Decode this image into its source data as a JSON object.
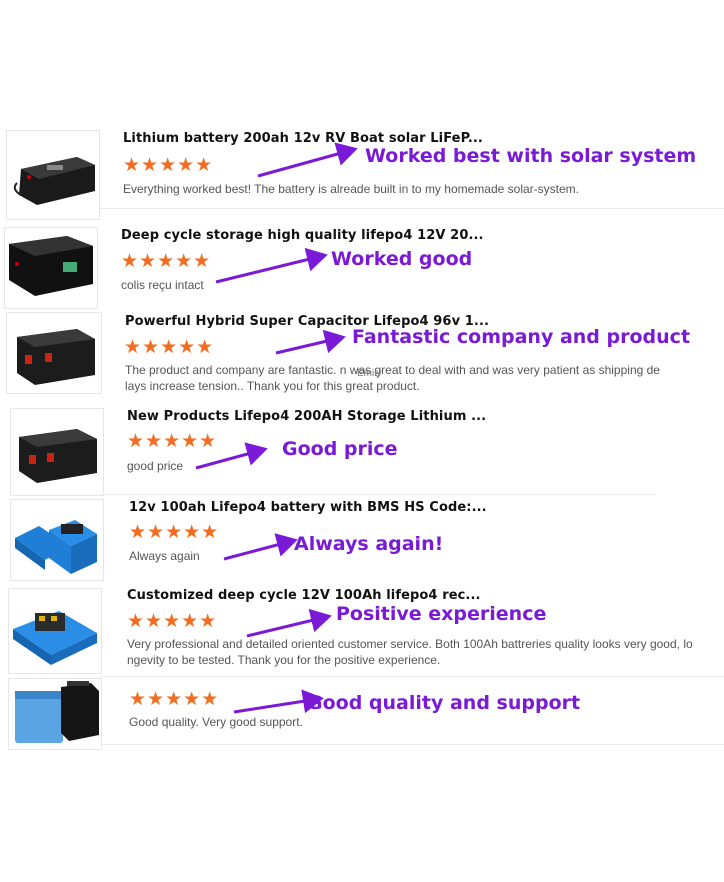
{
  "colors": {
    "star": "#f26d21",
    "annotation": "#7a1ad6"
  },
  "reviews": [
    {
      "title": "Lithium battery 200ah 12v RV Boat solar LiFeP...",
      "stars": "★★★★★",
      "text1": "Everything worked best! The battery is alreade built in to my homemade solar-system.",
      "text2": "",
      "annotation": "Worked best with solar system",
      "icon": "black-battery-box-icon"
    },
    {
      "title": "Deep cycle storage high quality lifepo4 12V 20...",
      "stars": "★★★★★",
      "text1": "colis reçu intact",
      "text2": "",
      "annotation": "Worked good",
      "icon": "black-battery-box-icon"
    },
    {
      "title": "Powerful Hybrid Super Capacitor Lifepo4 96v 1...",
      "stars": "★★★★★",
      "text1": "The product and company are fantastic.      n was great to deal with and was very patient as shipping de",
      "text2": "lays increase tension..  Thank you for this great product.",
      "annotation": "Fantastic company and product",
      "reviewer": "Emily",
      "icon": "black-battery-box-icon"
    },
    {
      "title": "New Products Lifepo4 200AH Storage Lithium ...",
      "stars": "★★★★★",
      "text1": "good price",
      "text2": "",
      "annotation": "Good price",
      "icon": "black-battery-box-icon"
    },
    {
      "title": "12v 100ah Lifepo4 battery with BMS HS Code:...",
      "stars": "★★★★★",
      "text1": "Always again",
      "text2": "",
      "annotation": "Always again!",
      "icon": "blue-battery-box-icon"
    },
    {
      "title": "Customized deep cycle 12V 100Ah lifepo4 rec...",
      "stars": "★★★★★",
      "text1": "Very professional and detailed oriented customer service. Both 100Ah battreries quality looks very good, lo",
      "text2": "ngevity to be tested. Thank you for the positive experience.",
      "annotation": "Positive experience",
      "icon": "blue-battery-box-icon"
    },
    {
      "title": "",
      "stars": "★★★★★",
      "text1": "Good quality.  Very good support.",
      "text2": "",
      "annotation": "Good quality and support",
      "icon": "blue-battery-box-icon"
    }
  ]
}
